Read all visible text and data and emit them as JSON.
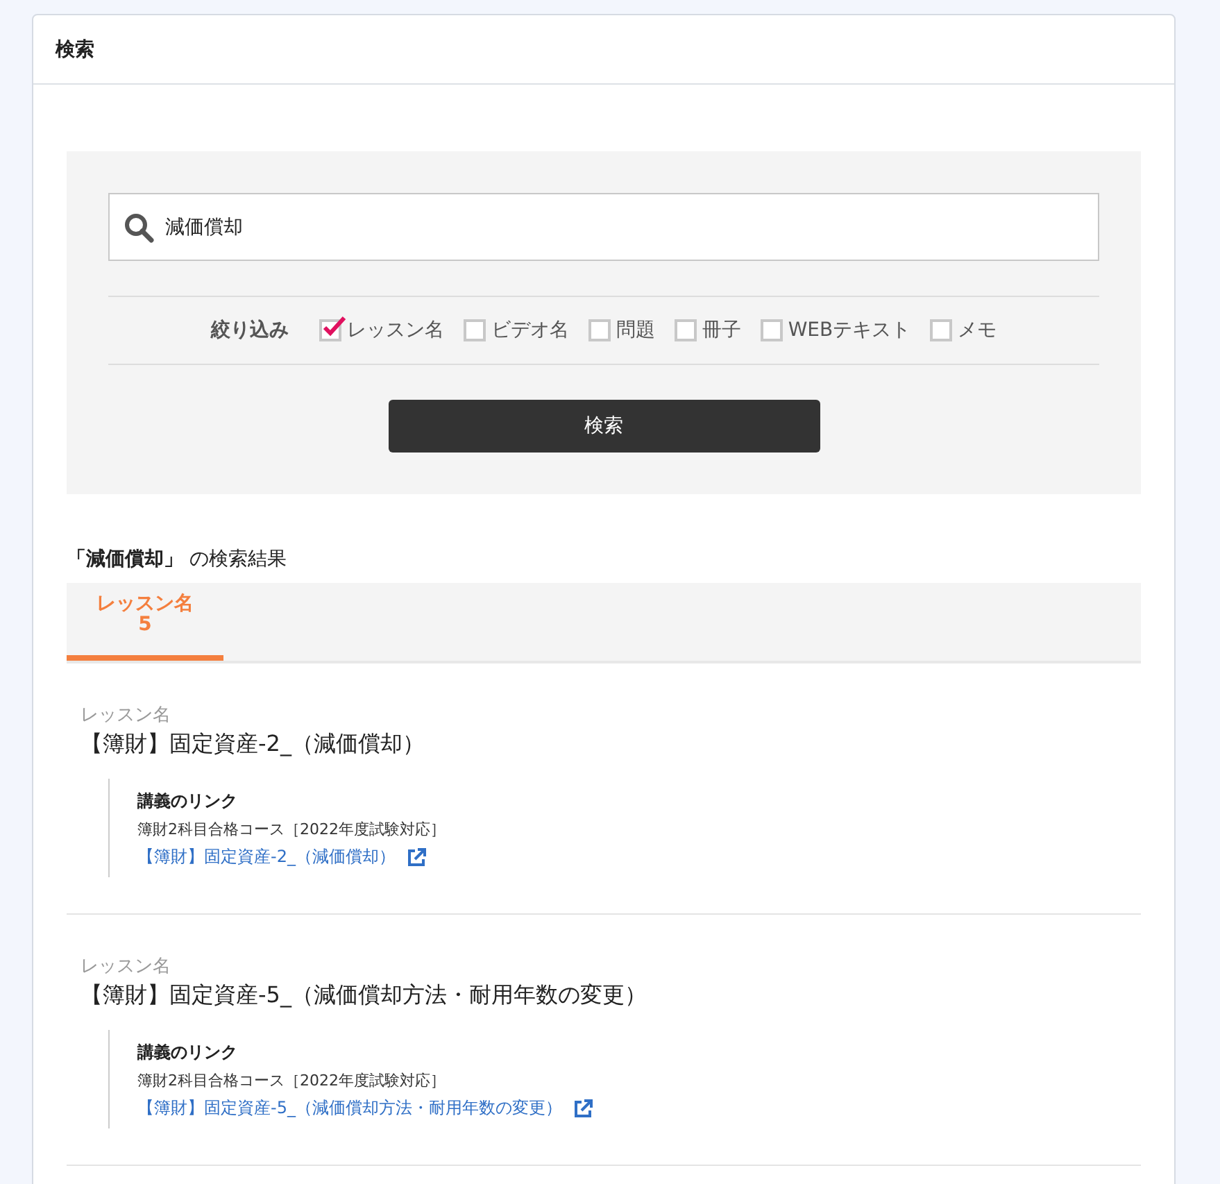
{
  "card": {
    "title": "検索"
  },
  "search": {
    "value": "減価償却",
    "filter_label": "絞り込み",
    "filters": [
      {
        "label": "レッスン名",
        "checked": true
      },
      {
        "label": "ビデオ名",
        "checked": false
      },
      {
        "label": "問題",
        "checked": false
      },
      {
        "label": "冊子",
        "checked": false
      },
      {
        "label": "WEBテキスト",
        "checked": false
      },
      {
        "label": "メモ",
        "checked": false
      }
    ],
    "button": "検索"
  },
  "results": {
    "heading": "**「減価償却」** の検索結果",
    "tabs": [
      {
        "label": "レッスン名",
        "count": "5",
        "selected": true
      }
    ],
    "items": [
      {
        "category": "レッスン名",
        "title": "【簿財】固定資産-2_（減価償却）",
        "link_heading": "講義のリンク",
        "course": "簿財2科目合格コース［2022年度試験対応］",
        "link": "【簿財】固定資産-2_（減価償却）"
      },
      {
        "category": "レッスン名",
        "title": "【簿財】固定資産-5_（減価償却方法・耐用年数の変更）",
        "link_heading": "講義のリンク",
        "course": "簿財2科目合格コース［2022年度試験対応］",
        "link": "【簿財】固定資産-5_（減価償却方法・耐用年数の変更）"
      }
    ]
  }
}
